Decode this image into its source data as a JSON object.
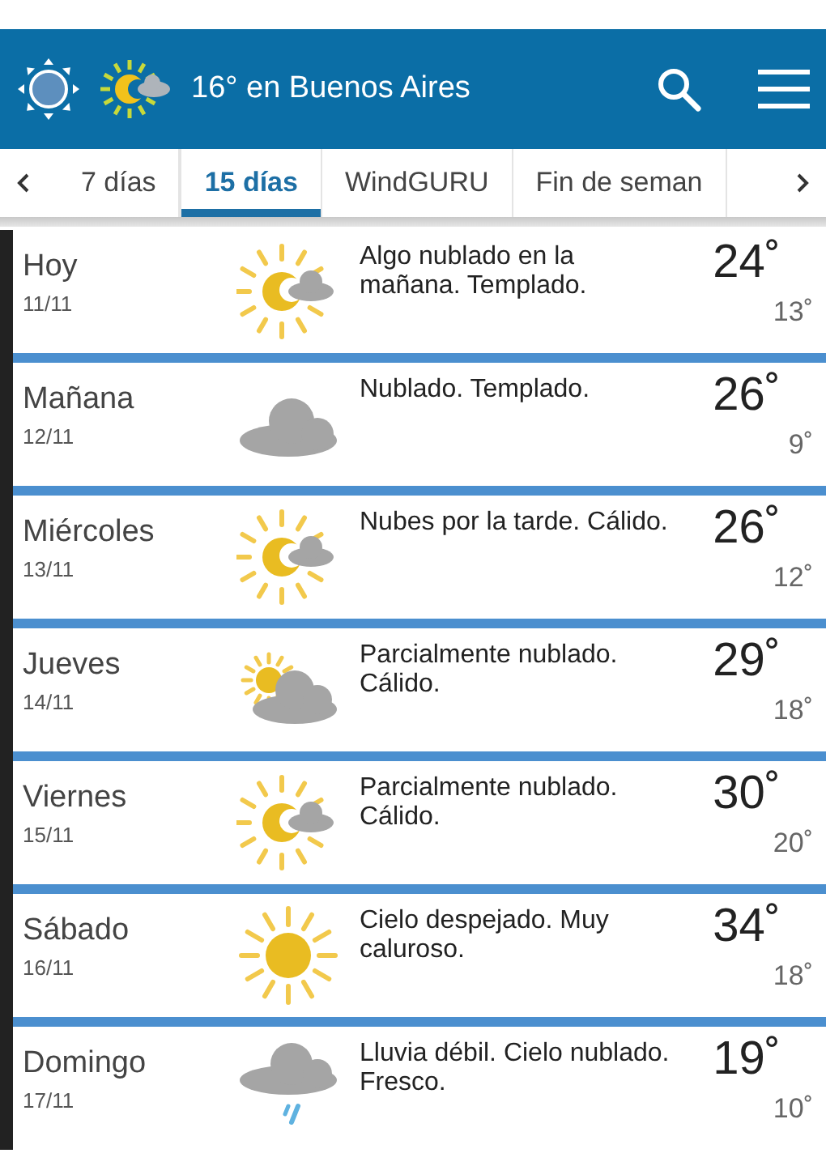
{
  "header": {
    "title": "16° en Buenos Aires"
  },
  "tabs": [
    {
      "label": "7 días",
      "selected": false
    },
    {
      "label": "15 días",
      "selected": true
    },
    {
      "label": "WindGURU",
      "selected": false
    },
    {
      "label": "Fin de seman",
      "selected": false
    }
  ],
  "days": [
    {
      "day": "Hoy",
      "date": "11/11",
      "kind": "sun_cloud",
      "summary": "Algo nublado en la mañana. Templado.",
      "high": "24˚",
      "low": "13˚"
    },
    {
      "day": "Mañana",
      "date": "12/11",
      "kind": "cloud",
      "summary": "Nublado. Templado.",
      "high": "26˚",
      "low": "9˚"
    },
    {
      "day": "Miércoles",
      "date": "13/11",
      "kind": "sun_cloud",
      "summary": "Nubes por la tarde. Cálido.",
      "high": "26˚",
      "low": "12˚"
    },
    {
      "day": "Jueves",
      "date": "14/11",
      "kind": "cloud_sun",
      "summary": "Parcialmente nublado. Cálido.",
      "high": "29˚",
      "low": "18˚"
    },
    {
      "day": "Viernes",
      "date": "15/11",
      "kind": "sun_cloud",
      "summary": "Parcialmente nublado. Cálido.",
      "high": "30˚",
      "low": "20˚"
    },
    {
      "day": "Sábado",
      "date": "16/11",
      "kind": "sun",
      "summary": "Cielo despejado. Muy caluroso.",
      "high": "34˚",
      "low": "18˚"
    },
    {
      "day": "Domingo",
      "date": "17/11",
      "kind": "rain",
      "summary": "Lluvia débil. Cielo nublado. Fresco.",
      "high": "19˚",
      "low": "10˚"
    }
  ]
}
